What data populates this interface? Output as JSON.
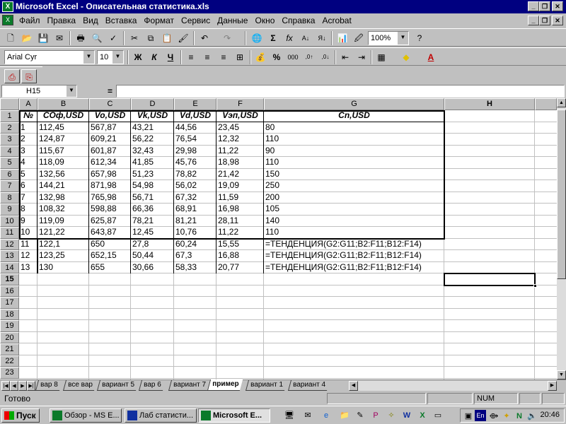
{
  "window": {
    "title": "Microsoft Excel - Описательная статистика.xls",
    "app_icon": "excel-icon"
  },
  "menu": [
    "Файл",
    "Правка",
    "Вид",
    "Вставка",
    "Формат",
    "Сервис",
    "Данные",
    "Окно",
    "Справка",
    "Acrobat"
  ],
  "toolbar": {
    "zoom": "100%",
    "font_name": "Arial Cyr",
    "font_size": "10",
    "bold": "Ж",
    "italic": "К",
    "underline": "Ч"
  },
  "namebox": "H15",
  "formula_eq": "=",
  "columns": [
    "A",
    "B",
    "C",
    "D",
    "E",
    "F",
    "G",
    "H"
  ],
  "selected_column": "H",
  "rows": [
    "1",
    "2",
    "3",
    "4",
    "5",
    "6",
    "7",
    "8",
    "9",
    "10",
    "11",
    "12",
    "13",
    "14",
    "15",
    "16",
    "17",
    "18",
    "19",
    "20",
    "21",
    "22",
    "23"
  ],
  "selected_row": "15",
  "headers": [
    "№",
    "СОф,USD",
    "Vo,USD",
    "Vk,USD",
    "Vd,USD",
    "Vэп,USD",
    "Cn,USD"
  ],
  "data": [
    [
      "1",
      "112,45",
      "567,87",
      "43,21",
      "44,56",
      "23,45",
      "80"
    ],
    [
      "2",
      "124,87",
      "609,21",
      "56,22",
      "76,54",
      "12,32",
      "110"
    ],
    [
      "3",
      "115,67",
      "601,87",
      "32,43",
      "29,98",
      "11,22",
      "90"
    ],
    [
      "4",
      "118,09",
      "612,34",
      "41,85",
      "45,76",
      "18,98",
      "110"
    ],
    [
      "5",
      "132,56",
      "657,98",
      "51,23",
      "78,82",
      "21,42",
      "150"
    ],
    [
      "6",
      "144,21",
      "871,98",
      "54,98",
      "56,02",
      "19,09",
      "250"
    ],
    [
      "7",
      "132,98",
      "765,98",
      "56,71",
      "67,32",
      "11,59",
      "200"
    ],
    [
      "8",
      "108,32",
      "598,88",
      "66,36",
      "68,91",
      "16,98",
      "105"
    ],
    [
      "9",
      "119,09",
      "625,87",
      "78,21",
      "81,21",
      "28,11",
      "140"
    ],
    [
      "10",
      "121,22",
      "643,87",
      "12,45",
      "10,76",
      "11,22",
      "110"
    ],
    [
      "11",
      "122,1",
      "650",
      "27,8",
      "60,24",
      "15,55",
      "=ТЕНДЕНЦИЯ(G2:G11;B2:F11;B12:F14)"
    ],
    [
      "12",
      "123,25",
      "652,15",
      "50,44",
      "67,3",
      "16,88",
      "=ТЕНДЕНЦИЯ(G2:G11;B2:F11;B12:F14)"
    ],
    [
      "13",
      "130",
      "655",
      "30,66",
      "58,33",
      "20,77",
      "=ТЕНДЕНЦИЯ(G2:G11;B2:F11;B12:F14)"
    ]
  ],
  "sheet_tabs": [
    "вар 8",
    "все вар",
    "вариант 5",
    "вар 6",
    "вариант 7",
    "пример",
    "вариант 1",
    "вариант 4"
  ],
  "active_sheet": "пример",
  "status": {
    "text": "Готово",
    "num": "NUM"
  },
  "taskbar": {
    "start": "Пуск",
    "tasks": [
      "Обзор - MS E...",
      "Лаб статисти...",
      "Microsoft E..."
    ],
    "active_task": "Microsoft E...",
    "tray_lang": "En",
    "clock": "20:46"
  }
}
